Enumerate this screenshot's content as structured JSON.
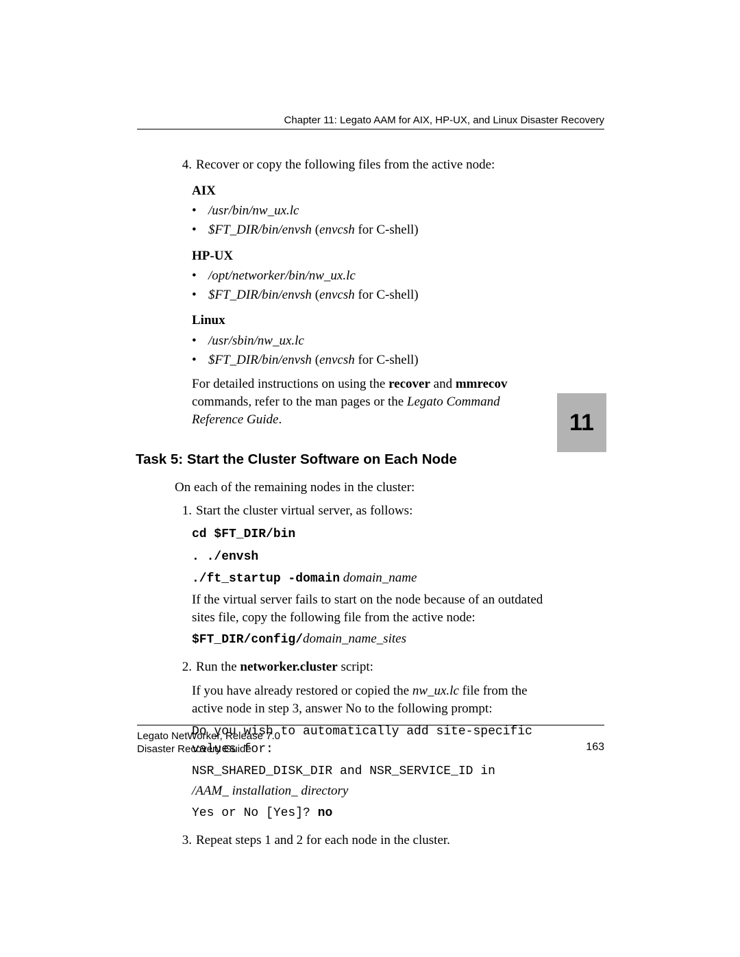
{
  "header": {
    "chapter_line": "Chapter 11: Legato AAM for AIX, HP-UX, and Linux Disaster Recovery"
  },
  "side_tab": {
    "number": "11"
  },
  "step4": {
    "num": "4.",
    "text": "Recover or copy the following files from the active node:",
    "aix": {
      "label": "AIX",
      "b1": "/usr/bin/nw_ux.lc",
      "b2a": "$FT_DIR/bin/envsh",
      "b2b": " (",
      "b2c": "envcsh",
      "b2d": " for C-shell)"
    },
    "hpux": {
      "label": "HP-UX",
      "b1": "/opt/networker/bin/nw_ux.lc",
      "b2a": "$FT_DIR/bin/envsh",
      "b2b": " (",
      "b2c": "envcsh",
      "b2d": " for C-shell)"
    },
    "linux": {
      "label": "Linux",
      "b1": "/usr/sbin/nw_ux.lc",
      "b2a": "$FT_DIR/bin/envsh",
      "b2b": " (",
      "b2c": "envcsh",
      "b2d": " for C-shell)"
    },
    "refs": {
      "pre": "For detailed instructions on using the ",
      "kw1": "recover",
      "mid1": " and ",
      "kw2": "mmrecov",
      "mid2": " commands, refer to the man pages or the ",
      "ital": "Legato Command Reference Guide",
      "post": "."
    }
  },
  "task5": {
    "heading": "Task 5: Start the Cluster Software on Each Node",
    "intro": "On each of the remaining nodes in the cluster:",
    "s1": {
      "num": "1.",
      "text": "Start the cluster virtual server, as follows:",
      "cmd1": "cd $FT_DIR/bin",
      "cmd2": ". ./envsh",
      "cmd3a": "./ft_startup -domain",
      "cmd3b": " domain_name",
      "fail": "If the virtual server fails to start on the node because of an outdated sites file, copy the following file from the active node:",
      "cfg_a": "$FT_DIR/config/",
      "cfg_b": "domain_name_sites"
    },
    "s2": {
      "num": "2.",
      "text_pre": "Run the ",
      "text_kw": "networker.cluster",
      "text_post": " script:",
      "restored_pre": "If you have already restored or copied the ",
      "restored_file": "nw_ux.lc",
      "restored_post": " file from the active node in step 3, answer No to the following prompt:",
      "prompt_l1": "Do you wish to automatically add site-specific values for:",
      "prompt_l2": "NSR_SHARED_DISK_DIR and NSR_SERVICE_ID in",
      "prompt_l3": "/AAM_ installation_ directory",
      "prompt_q": "Yes or No [Yes]? ",
      "prompt_a": "no"
    },
    "s3": {
      "num": "3.",
      "text": "Repeat steps 1 and 2 for each node in the cluster."
    }
  },
  "footer": {
    "line1": "Legato NetWorker, Release 7.0",
    "line2": "Disaster Recovery Guide",
    "page": "163"
  }
}
